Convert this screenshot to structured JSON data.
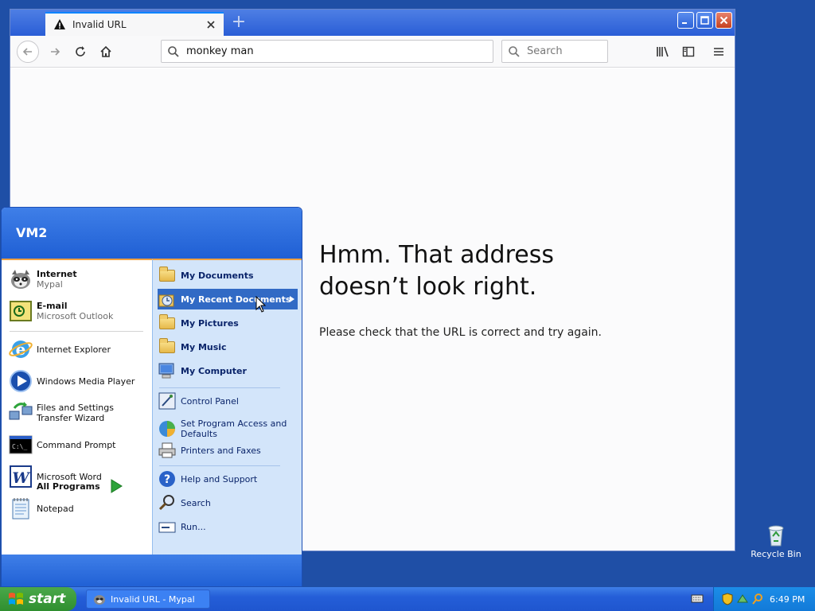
{
  "browser": {
    "tab_title": "Invalid URL",
    "new_tab_symbol": "+",
    "url_value": "monkey man",
    "search_placeholder": "Search",
    "error_title": "Hmm. That address doesn’t look right.",
    "error_message": "Please check that the URL is correct and try again."
  },
  "start_menu": {
    "user_name": "VM2",
    "pinned": [
      {
        "title": "Internet",
        "subtitle": "Mypal",
        "icon": "mypal-raccoon-icon"
      },
      {
        "title": "E-mail",
        "subtitle": "Microsoft Outlook",
        "icon": "outlook-icon"
      }
    ],
    "recent": [
      {
        "label": "Internet Explorer",
        "icon": "internet-explorer-icon"
      },
      {
        "label": "Windows Media Player",
        "icon": "media-player-icon"
      },
      {
        "label": "Files and Settings Transfer Wizard",
        "icon": "transfer-wizard-icon"
      },
      {
        "label": "Command Prompt",
        "icon": "command-prompt-icon"
      },
      {
        "label": "Microsoft Word",
        "icon": "word-icon"
      },
      {
        "label": "Notepad",
        "icon": "notepad-icon"
      }
    ],
    "all_programs": "All Programs",
    "places": [
      {
        "label": "My Documents"
      },
      {
        "label": "My Recent Documents"
      },
      {
        "label": "My Pictures"
      },
      {
        "label": "My Music"
      },
      {
        "label": "My Computer"
      }
    ],
    "system": [
      {
        "label": "Control Panel"
      },
      {
        "label": "Set Program Access and Defaults"
      },
      {
        "label": "Printers and Faxes"
      }
    ],
    "help": [
      {
        "label": "Help and Support"
      },
      {
        "label": "Search"
      },
      {
        "label": "Run..."
      }
    ]
  },
  "desktop": {
    "recycle_bin_label": "Recycle Bin"
  },
  "taskbar": {
    "start_label": "start",
    "task_item_label": "Invalid URL - Mypal",
    "clock": "6:49 PM"
  },
  "colors": {
    "desktop_bg": "#1f4fa6",
    "start_menu_blue": "#1f5fd4",
    "highlight": "#316ac5",
    "start_green": "#3a9a3a",
    "tab_accent": "#0a84ff"
  }
}
